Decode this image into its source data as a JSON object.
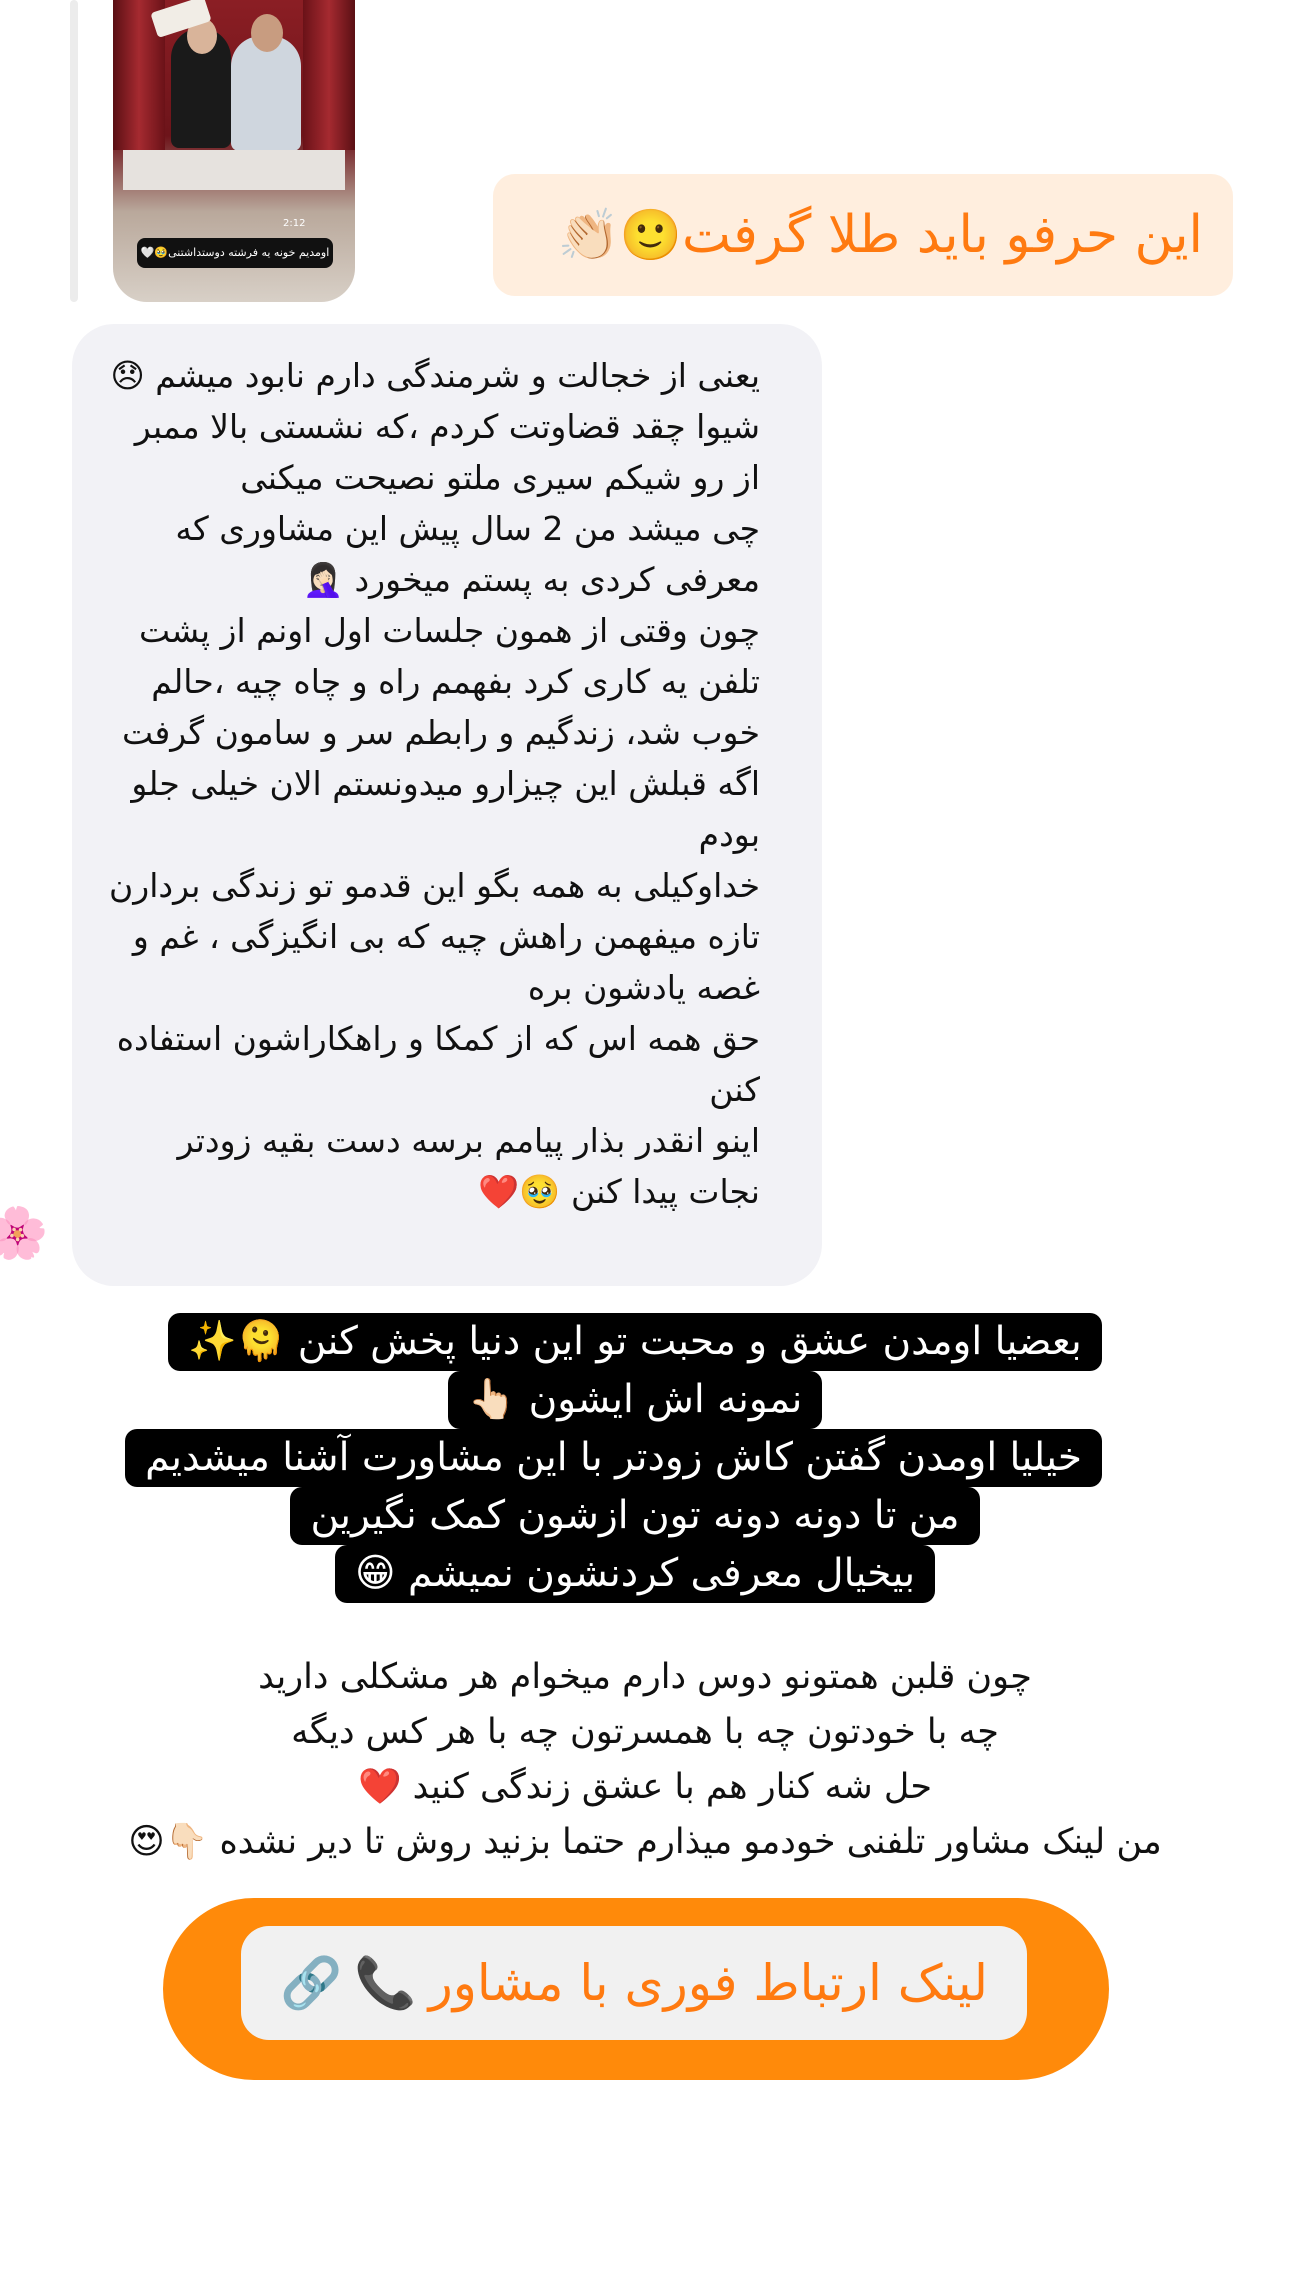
{
  "story": {
    "time": "2:12",
    "caption": "اومدیم خونه یه فرشته دوستداشتنی🥹🤍"
  },
  "reply": {
    "text": "این حرفو باید طلا گرفت",
    "emoji": "🙂👏🏻"
  },
  "message": {
    "paragraphs": [
      "یعنی از خجالت و شرمندگی دارم نابود میشم 😞",
      "شیوا چقد قضاوتت کردم ،که نشستی بالا ممبر از رو شیکم سیری ملتو نصیحت میکنی",
      "چی میشد من 2 سال پیش این مشاوری که معرفی کردی به پستم میخورد 🤦🏻‍♀️",
      "چون وقتی از همون جلسات اول اونم از پشت تلفن یه کاری کرد بفهمم راه و چاه چیه ،حالم خوب شد، زندگیم و رابطم سر و سامون گرفت",
      "اگه قبلش این چیزارو میدونستم الان خیلی جلو بودم",
      "خداوکیلی به همه بگو این قدمو تو زندگی بردارن تازه میفهمن راهش چیه که بی انگیزگی ، غم و غصه یادشون بره",
      "حق همه اس که از کمکا و راهکاراشون استفاده کنن",
      "اینو انقدر بذار پیامم برسه دست بقیه زودتر نجات پیدا کنن 🥹❤️"
    ]
  },
  "decor": {
    "flower": "🌸"
  },
  "highlight": {
    "lines": [
      "بعضیا اومدن عشق و محبت تو این دنیا پخش کنن 🫠✨",
      "نمونه اش ایشون 👆🏻",
      "خیلیا اومدن گفتن کاش زودتر با این مشاورت آشنا میشدیم",
      "من تا دونه دونه تون ازشون کمک نگیرین",
      "بیخیال معرفی کردنشون نمیشم 😁"
    ]
  },
  "body_text": {
    "lines": [
      "چون قلبن همتونو دوس دارم میخوام هر مشکلی دارید",
      "چه با خودتون چه با همسرتون چه با هر کس دیگه",
      "حل شه کنار هم با عشق زندگی کنید ❤️",
      "من لینک مشاور تلفنی خودمو میذارم حتما بزنید روش تا دیر نشده 👇🏻😍"
    ]
  },
  "cta": {
    "label": "لینک ارتباط فوری با مشاور",
    "phone_icon": "📞",
    "link_icon": "🔗"
  }
}
